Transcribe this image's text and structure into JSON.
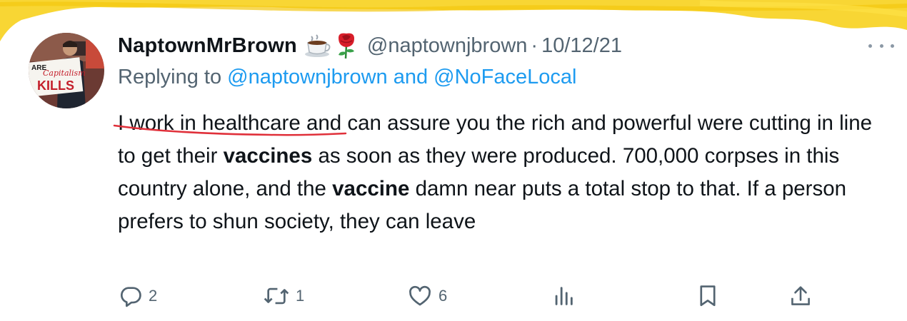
{
  "tweet": {
    "display_name": "NaptownMrBrown",
    "emoji": [
      "coffee-emoji",
      "rose-emoji"
    ],
    "handle": "@naptownjbrown",
    "separator": "·",
    "date": "10/12/21",
    "reply_prefix": "Replying to",
    "reply_to": "@naptownjbrown and @NoFaceLocal",
    "avatar_sign_text": [
      "ARE",
      "Capitalism",
      "KILLS"
    ],
    "body": {
      "seg1": "I work in healthcare and can assure you the rich and powerful were cutting in line to get their ",
      "bold1": "vaccines",
      "seg2": " as soon as they were produced. 700,000 corpses in this country alone, and the ",
      "bold2": "vaccine",
      "seg3": " damn near puts a total stop to that. If a person prefers to shun society, they can leave"
    },
    "actions": {
      "reply": {
        "icon": "reply-icon",
        "count": "2"
      },
      "retweet": {
        "icon": "retweet-icon",
        "count": "1"
      },
      "like": {
        "icon": "heart-icon",
        "count": "6"
      },
      "views": {
        "icon": "analytics-icon"
      },
      "bookmark": {
        "icon": "bookmark-icon"
      },
      "share": {
        "icon": "share-icon"
      }
    }
  },
  "colors": {
    "text": "#0f1419",
    "secondary": "#536471",
    "link": "#1d9bf0",
    "highlighter": "#f7d21e",
    "annotation": "#e0303a"
  }
}
